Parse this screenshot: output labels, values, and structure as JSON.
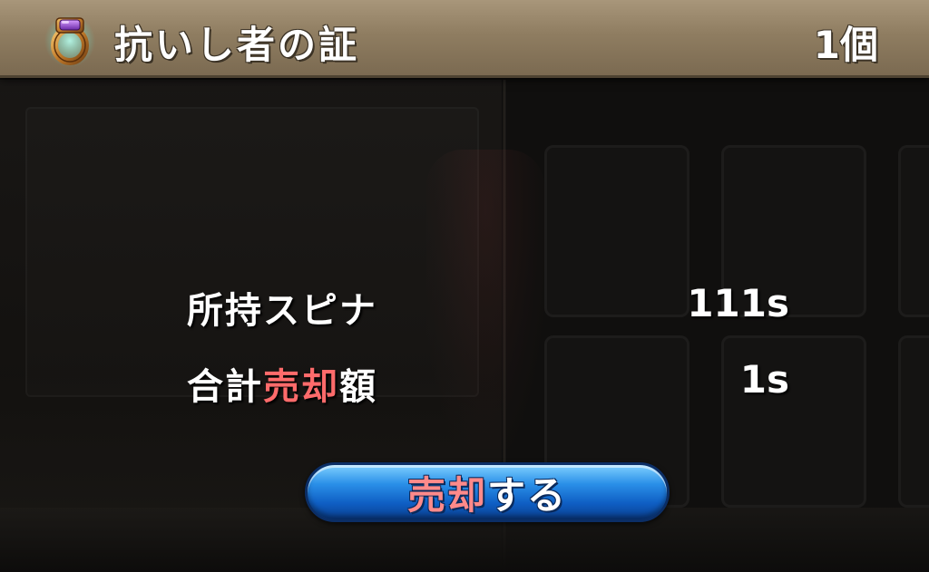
{
  "header": {
    "item_name": "抗いし者の証",
    "item_count": "1個",
    "item_icon": "ring-icon"
  },
  "sell_info": {
    "owned_label": "所持スピナ",
    "owned_value": "111s",
    "total_label_prefix": "合計",
    "total_label_highlight": "売却",
    "total_label_suffix": "額",
    "total_value": "1s"
  },
  "sell_button": {
    "label_highlight": "売却",
    "label_suffix": "する"
  },
  "colors": {
    "highlight": "#ff6b6b",
    "button_blue": "#2a8fe8",
    "header_tan": "#a8967a"
  }
}
